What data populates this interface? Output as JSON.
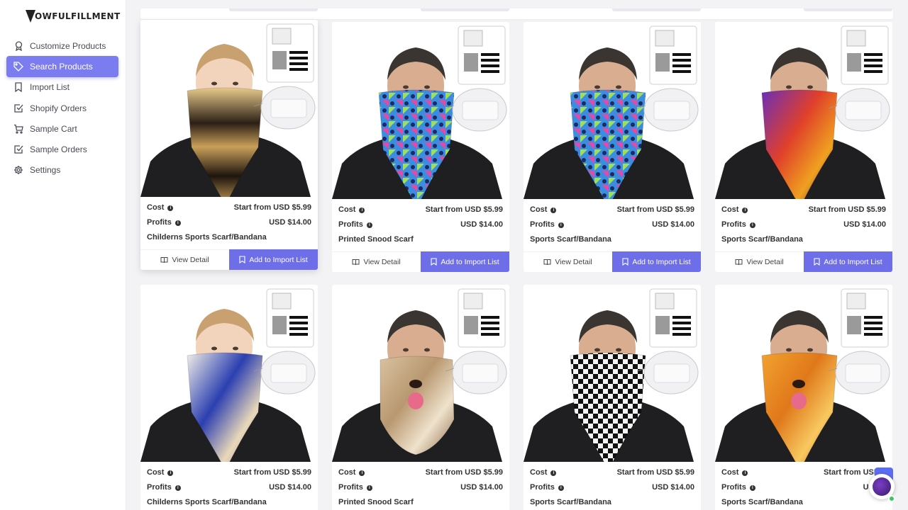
{
  "brand": {
    "logo_text": "OWFULFILLMENT"
  },
  "sidebar": {
    "items": [
      {
        "label": "Customize Products",
        "icon": "award-icon"
      },
      {
        "label": "Search Products",
        "icon": "tag-icon",
        "active": true
      },
      {
        "label": "Import List",
        "icon": "bookmark-icon"
      },
      {
        "label": "Shopify Orders",
        "icon": "checkbox-icon"
      },
      {
        "label": "Sample Cart",
        "icon": "cart-icon"
      },
      {
        "label": "Sample Orders",
        "icon": "checkbox-icon"
      },
      {
        "label": "Settings",
        "icon": "gear-icon"
      }
    ]
  },
  "labels": {
    "cost": "Cost",
    "profits": "Profits",
    "view_detail": "View Detail",
    "add_to_import": "Add to Import List"
  },
  "products": [
    {
      "name": "Childerns Sports Scarf/Bandana",
      "cost": "Start from USD $5.99",
      "profit": "USD $14.00",
      "pattern": "tribal",
      "model": "boy"
    },
    {
      "name": "Printed Snood Scarf",
      "cost": "Start from USD $5.99",
      "profit": "USD $14.00",
      "pattern": "cats",
      "model": "man"
    },
    {
      "name": "Sports Scarf/Bandana",
      "cost": "Start from USD $5.99",
      "profit": "USD $14.00",
      "pattern": "cats",
      "model": "man"
    },
    {
      "name": "Sports Scarf/Bandana",
      "cost": "Start from USD $5.99",
      "profit": "USD $14.00",
      "pattern": "purple",
      "model": "man"
    },
    {
      "name": "Childerns Sports Scarf/Bandana",
      "cost": "Start from USD $5.99",
      "profit": "USD $14.00",
      "pattern": "floral",
      "model": "boy"
    },
    {
      "name": "Printed Snood Scarf",
      "cost": "Start from USD $5.99",
      "profit": "USD $14.00",
      "pattern": "dog",
      "model": "man"
    },
    {
      "name": "Sports Scarf/Bandana",
      "cost": "Start from USD $5.99",
      "profit": "USD $14.00",
      "pattern": "checker",
      "model": "man"
    },
    {
      "name": "Sports Scarf/Bandana",
      "cost": "Start from USD $",
      "profit": "USD $",
      "pattern": "golden",
      "model": "man"
    }
  ],
  "colors": {
    "accent": "#6d6ee8",
    "active_nav": "#7b7cf0",
    "online": "#35c85a"
  }
}
